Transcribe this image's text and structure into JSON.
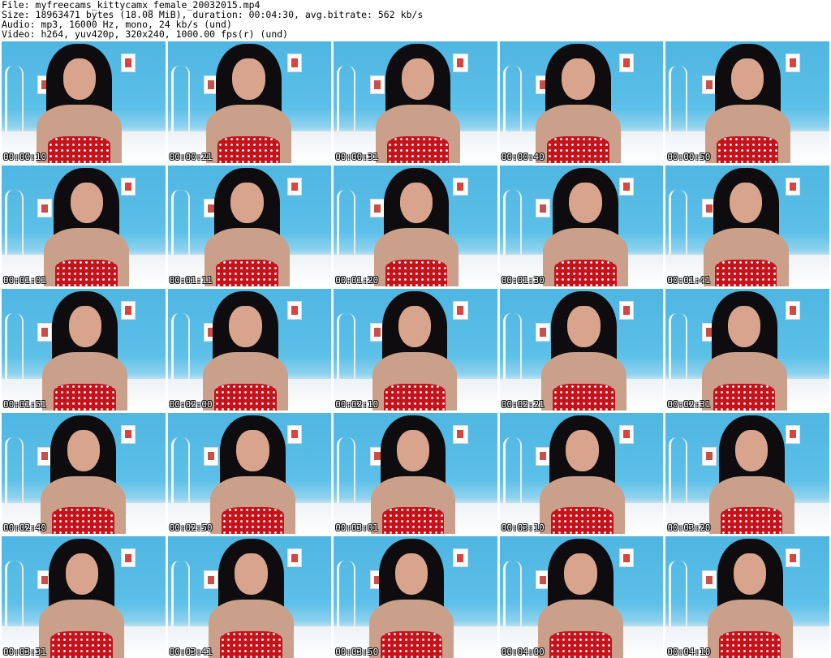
{
  "header": {
    "file": "File: myfreecams_kittycamx_female_20032015.mp4",
    "size": "Size: 18963471 bytes (18.08 MiB), duration: 00:04:30, avg.bitrate: 562 kb/s",
    "audio": "Audio: mp3, 16000 Hz, mono, 24 kb/s (und)",
    "video": "Video: h264, yuv420p, 320x240, 1000.00 fps(r) (und)"
  },
  "thumbnails": [
    {
      "timestamp": "00:00:10"
    },
    {
      "timestamp": "00:00:21"
    },
    {
      "timestamp": "00:00:31"
    },
    {
      "timestamp": "00:00:40"
    },
    {
      "timestamp": "00:00:50"
    },
    {
      "timestamp": "00:01:01"
    },
    {
      "timestamp": "00:01:11"
    },
    {
      "timestamp": "00:01:20"
    },
    {
      "timestamp": "00:01:30"
    },
    {
      "timestamp": "00:01:41"
    },
    {
      "timestamp": "00:01:51"
    },
    {
      "timestamp": "00:02:00"
    },
    {
      "timestamp": "00:02:10"
    },
    {
      "timestamp": "00:02:21"
    },
    {
      "timestamp": "00:02:31"
    },
    {
      "timestamp": "00:02:40"
    },
    {
      "timestamp": "00:02:50"
    },
    {
      "timestamp": "00:03:01"
    },
    {
      "timestamp": "00:03:10"
    },
    {
      "timestamp": "00:03:20"
    },
    {
      "timestamp": "00:03:31"
    },
    {
      "timestamp": "00:03:41"
    },
    {
      "timestamp": "00:03:50"
    },
    {
      "timestamp": "00:04:00"
    },
    {
      "timestamp": "00:04:10"
    }
  ],
  "colors": {
    "wall": "#4fb6e2",
    "hair": "#0e0c0f",
    "top": "#c5121b",
    "timestamp_text": "#ffffff"
  }
}
